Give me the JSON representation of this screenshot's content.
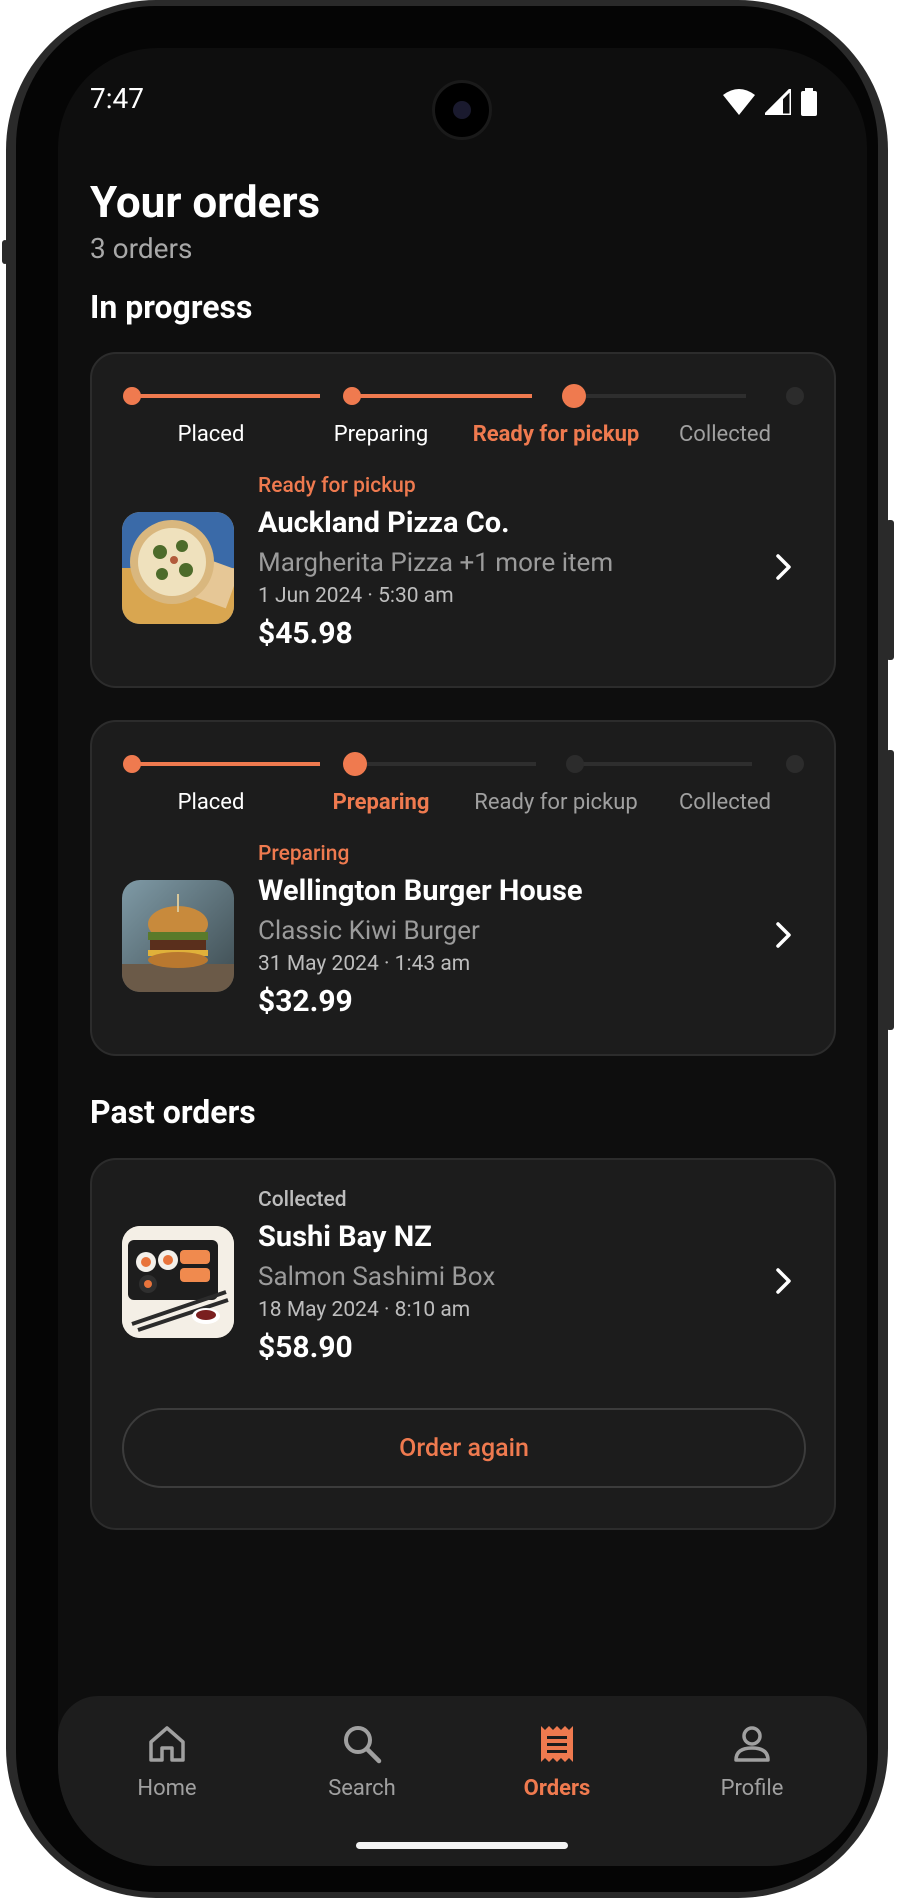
{
  "status_bar": {
    "time": "7:47"
  },
  "header": {
    "title": "Your orders",
    "subtitle": "3 orders"
  },
  "sections": {
    "in_progress": "In progress",
    "past": "Past orders"
  },
  "steps": [
    "Placed",
    "Preparing",
    "Ready for pickup",
    "Collected"
  ],
  "orders": [
    {
      "status": "Ready for pickup",
      "name": "Auckland Pizza Co.",
      "items": "Margherita Pizza +1 more item",
      "date": "1 Jun 2024 · 5:30 am",
      "price": "$45.98",
      "current_step": 3
    },
    {
      "status": "Preparing",
      "name": "Wellington Burger House",
      "items": "Classic Kiwi Burger",
      "date": "31 May 2024 · 1:43 am",
      "price": "$32.99",
      "current_step": 2
    },
    {
      "status": "Collected",
      "name": "Sushi Bay NZ",
      "items": "Salmon Sashimi Box",
      "date": "18 May 2024 · 8:10 am",
      "price": "$58.90",
      "action": "Order again"
    }
  ],
  "nav": [
    {
      "label": "Home",
      "icon": "home-icon"
    },
    {
      "label": "Search",
      "icon": "search-icon"
    },
    {
      "label": "Orders",
      "icon": "receipt-icon",
      "active": true
    },
    {
      "label": "Profile",
      "icon": "person-icon"
    }
  ],
  "colors": {
    "accent": "#ef7a4f",
    "background": "#0e0e0e",
    "card": "#1c1c1c",
    "inactive": "#a0a0a0"
  }
}
